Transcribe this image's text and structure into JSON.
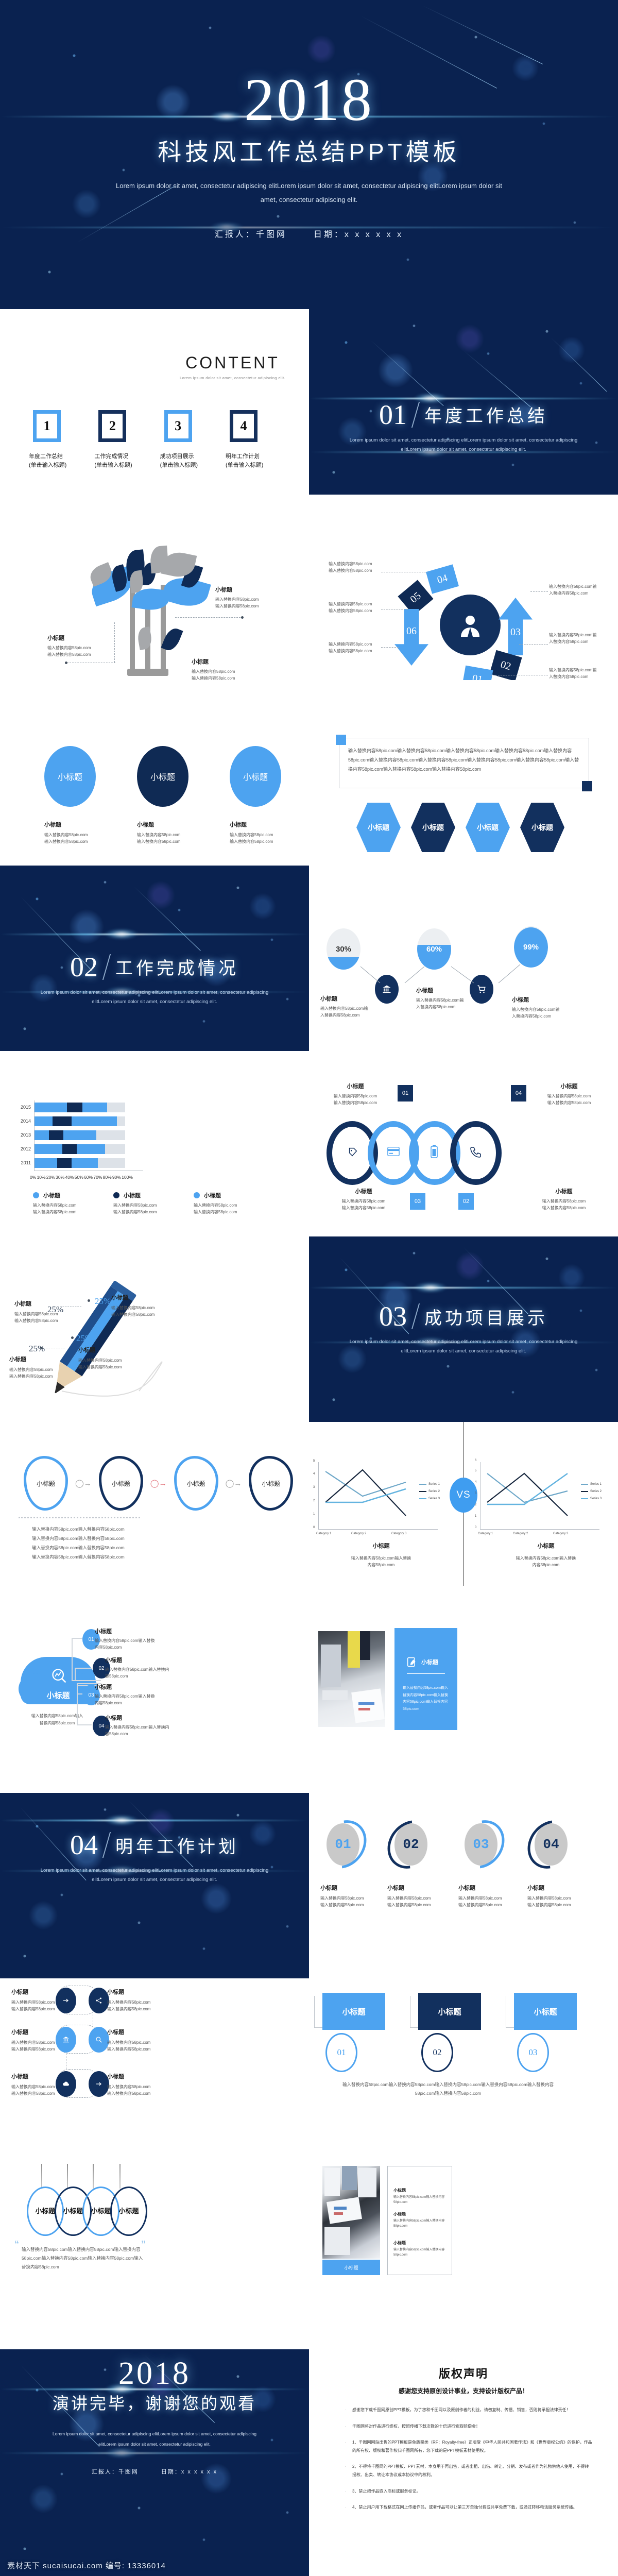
{
  "meta": {
    "brand_colors": {
      "light_blue": "#4da3f0",
      "deep_navy": "#12305e",
      "cosmic_bg": "#0a2250",
      "grey": "#9a9a9a"
    },
    "watermark": "素材天下 sucaisucai.com  编号: 13336014"
  },
  "cover": {
    "year": "2018",
    "title": "科技风工作总结PPT模板",
    "subtitle": "Lorem ipsum dolor sit amet, consectetur adipiscing elitLorem ipsum dolor sit amet, consectetur adipiscing elitLorem ipsum dolor sit amet, consectetur adipiscing elit.",
    "presenter_label": "汇报人：千图网",
    "date_label": "日期：x x x x x x"
  },
  "content_slide": {
    "heading": "CONTENT",
    "sub": "Lorem ipsum dolor sit amet, consectetur adipiscing elit.",
    "items": [
      {
        "num": "1",
        "title": "年度工作总结",
        "hint": "(单击输入标题)",
        "accent": "light"
      },
      {
        "num": "2",
        "title": "工作完成情况",
        "hint": "(单击输入标题)",
        "accent": "dark"
      },
      {
        "num": "3",
        "title": "成功项目展示",
        "hint": "(单击输入标题)",
        "accent": "light"
      },
      {
        "num": "4",
        "title": "明年工作计划",
        "hint": "(单击输入标题)",
        "accent": "dark"
      }
    ]
  },
  "sections": [
    {
      "num": "01",
      "title": "年度工作总结",
      "desc": "Lorem ipsum dolor sit amet, consectetur adipiscing elitLorem ipsum dolor sit amet, consectetur adipiscing elitLorem ipsum dolor sit amet, consectetur adipiscing elit."
    },
    {
      "num": "02",
      "title": "工作完成情况",
      "desc": "Lorem ipsum dolor sit amet, consectetur adipiscing elitLorem ipsum dolor sit amet, consectetur adipiscing elitLorem ipsum dolor sit amet, consectetur adipiscing elit."
    },
    {
      "num": "03",
      "title": "成功项目展示",
      "desc": "Lorem ipsum dolor sit amet, consectetur adipiscing elitLorem ipsum dolor sit amet, consectetur adipiscing elitLorem ipsum dolor sit amet, consectetur adipiscing elit."
    },
    {
      "num": "04",
      "title": "明年工作计划",
      "desc": "Lorem ipsum dolor sit amet, consectetur adipiscing elitLorem ipsum dolor sit amet, consectetur adipiscing elitLorem ipsum dolor sit amet, consectetur adipiscing elit."
    }
  ],
  "common": {
    "subtitle": "小标题",
    "body_line": "输入替换内容58pic.com",
    "body_two_lines": "输入替换内容58pic.com输入替换内容58pic.com"
  },
  "tree_slide": {
    "callouts": [
      {
        "title": "小标题",
        "l1": "输入替换内容58pic.com",
        "l2": "输入替换内容58pic.com"
      },
      {
        "title": "小标题",
        "l1": "输入替换内容58pic.com",
        "l2": "输入替换内容58pic.com"
      },
      {
        "title": "小标题",
        "l1": "输入替换内容58pic.com",
        "l2": "输入替换内容58pic.com"
      },
      {
        "title": "小标题",
        "l1": "输入替换内容58pic.com",
        "l2": "输入替换内容58pic.com"
      }
    ]
  },
  "arrow_slide": {
    "center_icon": "person-icon",
    "steps": [
      {
        "num": "01",
        "text": "输入替换内容58pic.com输入替换内容58pic.com"
      },
      {
        "num": "02",
        "text": "输入替换内容58pic.com输入替换内容58pic.com"
      },
      {
        "num": "03",
        "text": "输入替换内容58pic.com输入替换内容58pic.com"
      },
      {
        "num": "04",
        "text": "输入替换内容58pic.com输入替换内容58pic.com"
      },
      {
        "num": "05",
        "text": "输入替换内容58pic.com输入替换内容58pic.com"
      },
      {
        "num": "06",
        "text": "输入替换内容58pic.com输入替换内容58pic.com"
      }
    ]
  },
  "ellipse_slide": {
    "items": [
      {
        "inner": "小标题",
        "title": "小标题",
        "l1": "输入替换内容58pic.com",
        "l2": "输入替换内容58pic.com",
        "accent": "light"
      },
      {
        "inner": "小标题",
        "title": "小标题",
        "l1": "输入替换内容58pic.com",
        "l2": "输入替换内容58pic.com",
        "accent": "dark"
      },
      {
        "inner": "小标题",
        "title": "小标题",
        "l1": "输入替换内容58pic.com",
        "l2": "输入替换内容58pic.com",
        "accent": "light"
      }
    ]
  },
  "hex_slide": {
    "paragraph": "输入替换内容58pic.com输入替换内容58pic.com输入替换内容58pic.com输入替换内容58pic.com输入替换内容58pic.com输入替换内容58pic.com输入替换内容58pic.com输入替换内容58pic.com输入替换内容58pic.com输入替换内容58pic.com输入替换内容58pic.com输入替换内容58pic.com",
    "hexes": [
      {
        "label": "小标题",
        "accent": "light"
      },
      {
        "label": "小标题",
        "accent": "dark"
      },
      {
        "label": "小标题",
        "accent": "light"
      },
      {
        "label": "小标题",
        "accent": "dark"
      }
    ]
  },
  "gauge_slide": {
    "gauges": [
      {
        "pct": "30%",
        "fill": 30
      },
      {
        "pct": "60%",
        "fill": 60
      },
      {
        "pct": "99%",
        "fill": 99
      }
    ],
    "captions": [
      {
        "title": "小标题",
        "l1": "输入替换内容58pic.com输",
        "l2": "入替换内容58pic.com"
      },
      {
        "title": "小标题",
        "l1": "输入替换内容58pic.com输",
        "l2": "入替换内容58pic.com"
      },
      {
        "title": "小标题",
        "l1": "输入替换内容58pic.com输",
        "l2": "入替换内容58pic.com"
      }
    ],
    "icons": [
      "bank-icon",
      "cart-icon"
    ]
  },
  "chart_data": {
    "type": "bar",
    "orientation": "horizontal",
    "title": "",
    "categories": [
      "2015",
      "2014",
      "2013",
      "2012",
      "2011"
    ],
    "xlabel": "",
    "ylabel": "",
    "xlim": [
      0,
      100
    ],
    "xticks": [
      "0%",
      "10%",
      "20%",
      "30%",
      "40%",
      "50%",
      "60%",
      "70%",
      "80%",
      "90%",
      "100%"
    ],
    "grid": false,
    "series": [
      {
        "name": "小标题",
        "color": "#4da3f0",
        "values": [
          80,
          91,
          68,
          78,
          70
        ]
      },
      {
        "name": "小标题",
        "color": "#0f2a54",
        "values": [
          36,
          21,
          16,
          31,
          25
        ],
        "widths": [
          17,
          21,
          16,
          16,
          16
        ]
      },
      {
        "name": "小标题",
        "color": "#dde2e8",
        "values": [
          100,
          100,
          100,
          100,
          100
        ]
      }
    ],
    "legend": [
      {
        "label": "小标题",
        "color": "#4da3f0",
        "l1": "输入替换内容58pic.com",
        "l2": "输入替换内容58pic.com"
      },
      {
        "label": "小标题",
        "color": "#0f2a54",
        "l1": "输入替换内容58pic.com",
        "l2": "输入替换内容58pic.com"
      },
      {
        "label": "小标题",
        "color": "#4da3f0",
        "l1": "输入替换内容58pic.com",
        "l2": "输入替换内容58pic.com"
      }
    ]
  },
  "rings_slide": {
    "items": [
      {
        "num": "01",
        "title": "小标题",
        "l1": "输入替换内容58pic.com",
        "l2": "输入替换内容58pic.com",
        "accent": "dark",
        "icon": "tag-icon"
      },
      {
        "num": "02",
        "title": "小标题",
        "l1": "输入替换内容58pic.com",
        "l2": "输入替换内容58pic.com",
        "accent": "light",
        "icon": "phone-icon"
      },
      {
        "num": "03",
        "title": "小标题",
        "l1": "输入替换内容58pic.com",
        "l2": "输入替换内容58pic.com",
        "accent": "light",
        "icon": "card-icon"
      },
      {
        "num": "04",
        "title": "小标题",
        "l1": "输入替换内容58pic.com",
        "l2": "输入替换内容58pic.com",
        "accent": "dark",
        "icon": "battery-icon"
      }
    ]
  },
  "pencil_slide": {
    "items": [
      {
        "pct": "25%",
        "title": "小标题",
        "l1": "输入替换内容58pic.com",
        "l2": "输入替换内容58pic.com"
      },
      {
        "pct": "25%",
        "title": "小标题",
        "l1": "输入替换内容58pic.com",
        "l2": "输入替换内容58pic.com"
      },
      {
        "pct": "25%",
        "title": "小标题",
        "l1": "输入替换内容58pic.com",
        "l2": "输入替换内容58pic.com"
      },
      {
        "pct": "25%",
        "title": "小标题",
        "l1": "输入替换内容58pic.com",
        "l2": "输入替换内容58pic.com"
      }
    ]
  },
  "blob_slide": {
    "blobs": [
      {
        "label": "小标题",
        "accent": "light"
      },
      {
        "label": "小标题",
        "accent": "dark"
      },
      {
        "label": "小标题",
        "accent": "light"
      },
      {
        "label": "小标题",
        "accent": "dark"
      }
    ],
    "paragraph": "输入替换内容58pic.com输入替换内容58pic.com输入替换内容58pic.com输入替换内容58pic.com输入替换内容58pic.com输入替换内容58pic.com输入替换内容58pic.com输入替换内容58pic.com"
  },
  "vs_slide": {
    "vs_label": "VS",
    "left": {
      "caption": "小标题",
      "desc": "输入替换内容58pic.com输入替换内容58pic.com",
      "chart": {
        "type": "line",
        "categories": [
          "Category 1",
          "Category 2",
          "Category 3"
        ],
        "ylim": [
          0,
          5
        ],
        "yticks": [
          0,
          1,
          2,
          3,
          4,
          5
        ],
        "series": [
          {
            "name": "Series 1",
            "color": "#6fa8c9",
            "values": [
              4.3,
              2.5,
              3.5
            ]
          },
          {
            "name": "Series 2",
            "color": "#16263d",
            "values": [
              2.4,
              4.4,
              1.8
            ]
          },
          {
            "name": "Series 3",
            "color": "#64b4e0",
            "values": [
              2.0,
              2.0,
              3.0
            ]
          }
        ]
      }
    },
    "right": {
      "caption": "小标题",
      "desc": "输入替换内容58pic.com输入替换内容58pic.com",
      "chart": {
        "type": "line",
        "categories": [
          "Category 1",
          "Category 2",
          "Category 3"
        ],
        "ylim": [
          0,
          6
        ],
        "yticks": [
          0,
          1,
          2,
          3,
          4,
          5,
          6
        ],
        "series": [
          {
            "name": "Series 1",
            "color": "#6fa8c9",
            "values": [
              5.0,
              2.4,
              3.4
            ]
          },
          {
            "name": "Series 2",
            "color": "#16263d",
            "values": [
              2.4,
              5.0,
              1.8
            ]
          },
          {
            "name": "Series 3",
            "color": "#64b4e0",
            "values": [
              2.0,
              2.0,
              5.0
            ]
          }
        ]
      }
    }
  },
  "cloud_slide": {
    "cloud_label": "小标题",
    "cloud_icon": "search-chart-icon",
    "cloud_note_l1": "输入替换内容58pic.com输入",
    "cloud_note_l2": "替换内容58pic.com",
    "items": [
      {
        "num": "01",
        "title": "小标题",
        "text": "输入替换内容58pic.com输入替换内容58pic.com",
        "accent": "light"
      },
      {
        "num": "02",
        "title": "小标题",
        "text": "输入替换内容58pic.com输入替换内容58pic.com",
        "accent": "dark"
      },
      {
        "num": "03",
        "title": "小标题",
        "text": "输入替换内容58pic.com输入替换内容58pic.com",
        "accent": "light"
      },
      {
        "num": "04",
        "title": "小标题",
        "text": "输入替换内容58pic.com输入替换内容58pic.com",
        "accent": "dark"
      }
    ]
  },
  "photo_panel_slide": {
    "panel_title": "小标题",
    "panel_icon": "edit-note-icon",
    "panel_text": "输入替换内容58pic.com输入替换内容58pic.com输入替换内容58pic.com输入替换内容58pic.com"
  },
  "badges_slide": {
    "items": [
      {
        "num": "01",
        "title": "小标题",
        "l1": "输入替换内容58pic.com",
        "l2": "输入替换内容58pic.com",
        "accent": "light"
      },
      {
        "num": "02",
        "title": "小标题",
        "l1": "输入替换内容58pic.com",
        "l2": "输入替换内容58pic.com",
        "accent": "dark"
      },
      {
        "num": "03",
        "title": "小标题",
        "l1": "输入替换内容58pic.com",
        "l2": "输入替换内容58pic.com",
        "accent": "light"
      },
      {
        "num": "04",
        "title": "小标题",
        "l1": "输入替换内容58pic.com",
        "l2": "输入替换内容58pic.com",
        "accent": "dark"
      }
    ]
  },
  "flow_slide": {
    "items": [
      {
        "title": "小标题",
        "l1": "输入替换内容58pic.com",
        "l2": "输入替换内容58pic.com",
        "icon": "share-arrow-icon",
        "accent": "dark"
      },
      {
        "title": "小标题",
        "l1": "输入替换内容58pic.com",
        "l2": "输入替换内容58pic.com",
        "icon": "network-icon",
        "accent": "dark"
      },
      {
        "title": "小标题",
        "l1": "输入替换内容58pic.com",
        "l2": "输入替换内容58pic.com",
        "icon": "bank-icon",
        "accent": "light"
      },
      {
        "title": "小标题",
        "l1": "输入替换内容58pic.com",
        "l2": "输入替换内容58pic.com",
        "icon": "search-icon",
        "accent": "light"
      },
      {
        "title": "小标题",
        "l1": "输入替换内容58pic.com",
        "l2": "输入替换内容58pic.com",
        "icon": "cloud-icon",
        "accent": "dark"
      },
      {
        "title": "小标题",
        "l1": "输入替换内容58pic.com",
        "l2": "输入替换内容58pic.com",
        "icon": "share-arrow-icon",
        "accent": "dark"
      }
    ]
  },
  "banner_slide": {
    "cards": [
      {
        "label": "小标题",
        "num": "01",
        "accent": "light"
      },
      {
        "label": "小标题",
        "num": "02",
        "accent": "dark"
      },
      {
        "label": "小标题",
        "num": "03",
        "accent": "light"
      }
    ],
    "paragraph": "输入替换内容58pic.com输入替换内容58pic.com输入替换内容58pic.com输入替换内容58pic.com输入替换内容58pic.com输入替换内容58pic.com"
  },
  "hanging_slide": {
    "ovals": [
      {
        "label": "小标题",
        "accent": "light"
      },
      {
        "label": "小标题",
        "accent": "dark"
      },
      {
        "label": "小标题",
        "accent": "light"
      },
      {
        "label": "小标题",
        "accent": "dark"
      }
    ],
    "quote": "输入替换内容58pic.com输入替换内容58pic.com输入替换内容58pic.com输入替换内容58pic.com输入替换内容58pic.com输入替换内容58pic.com"
  },
  "photo_list_slide": {
    "button_label": "小标题",
    "items": [
      {
        "title": "小标题",
        "text": "输入替换内容58pic.com输入替换内容58pic.com"
      },
      {
        "title": "小标题",
        "text": "输入替换内容58pic.com输入替换内容58pic.com"
      },
      {
        "title": "小标题",
        "text": "输入替换内容58pic.com输入替换内容58pic.com"
      }
    ]
  },
  "thanks": {
    "year": "2018",
    "title": "演讲完毕，谢谢您的观看",
    "subtitle": "Lorem ipsum dolor sit amet, consectetur adipiscing elitLorem ipsum dolor sit amet, consectetur adipiscing elitLorem ipsum dolor sit amet, consectetur adipiscing elit.",
    "presenter_label": "汇报人：千图网",
    "date_label": "日期：x x x x x x"
  },
  "copyright": {
    "title": "版权声明",
    "subtitle": "感谢您支持原创设计事业，支持设计版权产品！",
    "items": [
      "感谢您下载千图网原创PPT模板，为了您和千图网以及原创作者的利益，请勿复制、传播、销售，否则将承担法律责任！",
      "千图网将对作品进行维权，按照传播下载次数的十倍进行索取赔偿金！",
      "1、千图网网站出售的PPT模板是免版税类（RF：Royalty-free）正版受《中华人民共和国著作法》和《世界版权公约》的保护，作品的所有权、版权和著作权归千图网所有，您下载的是PPT模板素材使用权。",
      "2、不得将千图网的PPT模板、PPT素材，本身用于再出售，或者出租、出借、转让、分销、发布或者作为礼物供他人使用，不得转授权、出卖、转让本协议或本协议中的权利。",
      "3、禁止把作品嵌入商标或服务标记。",
      "4、禁止用户用下载格式在网上传播作品，或者作品可以让第三方单独付费或共享免费下载，或通过转移电话服务系统传播。"
    ]
  }
}
